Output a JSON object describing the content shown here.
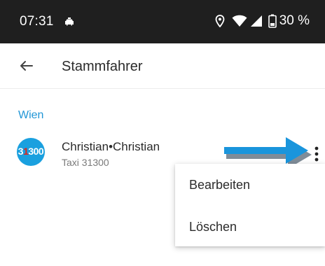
{
  "status_bar": {
    "time": "07:31",
    "battery": "30 %"
  },
  "app_bar": {
    "title": "Stammfahrer"
  },
  "section": {
    "label": "Wien"
  },
  "driver": {
    "avatar_prefix": "3",
    "avatar_highlight": "1",
    "avatar_suffix": "300",
    "name": "Christian•Christian",
    "subtitle": "Taxi 31300"
  },
  "menu": {
    "items": [
      {
        "label": "Bearbeiten"
      },
      {
        "label": "Löschen"
      }
    ]
  },
  "colors": {
    "accent": "#2196d6",
    "status_bar": "#1f1f1f",
    "avatar": "#1aa0df",
    "avatar_highlight": "#e2231a"
  },
  "icons": [
    "taxi-icon",
    "location-icon",
    "wifi-icon",
    "signal-icon",
    "battery-icon",
    "back-arrow-icon",
    "more-vert-icon",
    "annotation-arrow"
  ]
}
